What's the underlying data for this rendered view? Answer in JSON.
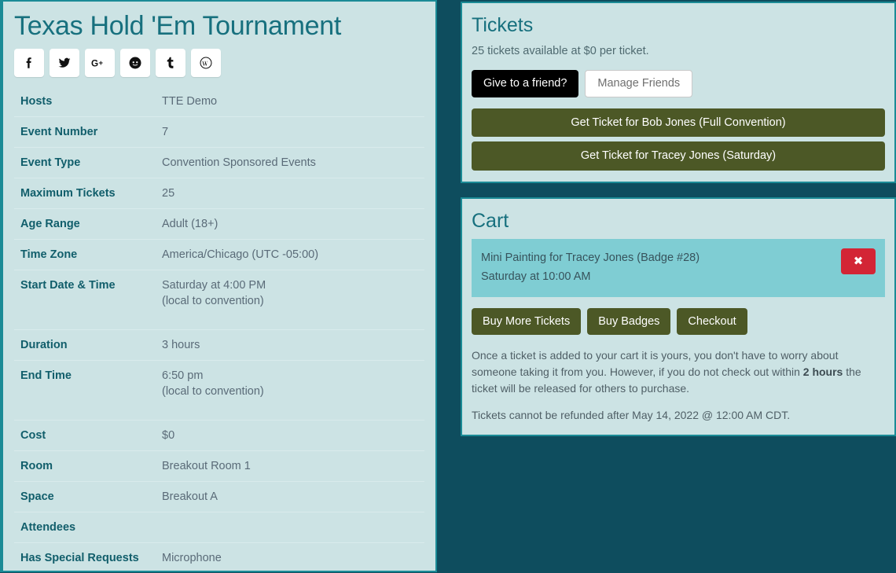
{
  "event": {
    "title": "Texas Hold 'Em Tournament",
    "social": [
      {
        "name": "facebook-icon",
        "label": "f"
      },
      {
        "name": "twitter-icon",
        "label": "t"
      },
      {
        "name": "google-plus-icon",
        "label": "G+"
      },
      {
        "name": "reddit-icon",
        "label": "r"
      },
      {
        "name": "tumblr-icon",
        "label": "t"
      },
      {
        "name": "wordpress-icon",
        "label": "W"
      }
    ],
    "details": [
      {
        "label": "Hosts",
        "value": "TTE Demo",
        "sub": ""
      },
      {
        "label": "Event Number",
        "value": "7",
        "sub": ""
      },
      {
        "label": "Event Type",
        "value": "Convention Sponsored Events",
        "sub": ""
      },
      {
        "label": "Maximum Tickets",
        "value": "25",
        "sub": ""
      },
      {
        "label": "Age Range",
        "value": "Adult (18+)",
        "sub": ""
      },
      {
        "label": "Time Zone",
        "value": "America/Chicago (UTC -05:00)",
        "sub": ""
      },
      {
        "label": "Start Date & Time",
        "value": "Saturday at 4:00 PM",
        "sub": "(local to convention)"
      },
      {
        "label": "Duration",
        "value": "3 hours",
        "sub": ""
      },
      {
        "label": "End Time",
        "value": "6:50 pm",
        "sub": "(local to convention)"
      },
      {
        "label": "Cost",
        "value": "$0",
        "sub": ""
      },
      {
        "label": "Room",
        "value": "Breakout Room 1",
        "sub": ""
      },
      {
        "label": "Space",
        "value": "Breakout A",
        "sub": ""
      },
      {
        "label": "Attendees",
        "value": "",
        "sub": ""
      },
      {
        "label": "Has Special Requests",
        "value": "Microphone",
        "sub": ""
      }
    ]
  },
  "tickets": {
    "title": "Tickets",
    "availability": "25 tickets available at $0 per ticket.",
    "give_to_friend_label": "Give to a friend?",
    "manage_friends_label": "Manage Friends",
    "get_ticket_buttons": [
      "Get Ticket for Bob Jones (Full Convention)",
      "Get Ticket for Tracey Jones (Saturday)"
    ]
  },
  "cart": {
    "title": "Cart",
    "items": [
      {
        "name": "Mini Painting for Tracey Jones (Badge #28)",
        "time": "Saturday at 10:00 AM",
        "remove_label": "✖"
      }
    ],
    "actions": [
      "Buy More Tickets",
      "Buy Badges",
      "Checkout"
    ],
    "notice_part1": "Once a ticket is added to your cart it is yours, you don't have to worry about someone taking it from you. However, if you do not check out within ",
    "notice_bold": "2 hours",
    "notice_part2": " the ticket will be released for others to purchase.",
    "refund_notice": "Tickets cannot be refunded after May 14, 2022 @ 12:00 AM CDT."
  },
  "colors": {
    "background": "#0e4d5e",
    "panel": "#cce3e4",
    "panel_border": "#1b8b96",
    "heading": "#17707e",
    "label": "#115e6b",
    "olive": "#4c5826",
    "cart_item": "#7fcdd3",
    "remove": "#d32535"
  }
}
